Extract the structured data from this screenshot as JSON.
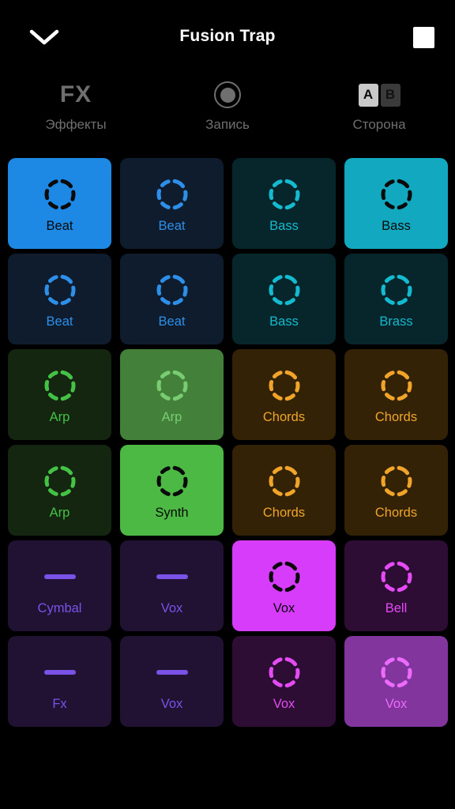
{
  "header": {
    "collapse_icon": "chevron-down-icon",
    "title": "Fusion Trap",
    "stop_icon": "stop-square-icon"
  },
  "toolbar": {
    "items": [
      {
        "glyph": "FX",
        "icon": "fx-icon",
        "label": "Эффекты"
      },
      {
        "glyph": "",
        "icon": "record-circle-icon",
        "label": "Запись"
      },
      {
        "glyph": "",
        "icon": "ab-switch-icon",
        "label": "Сторона",
        "a_label": "A",
        "b_label": "B",
        "selected": "A"
      }
    ]
  },
  "palette": {
    "blue_active_bg": "#1E88E5",
    "blue_idle_bg": "#0E1C2E",
    "blue_accent": "#2D8FE8",
    "teal_active_bg": "#12A8C0",
    "teal_idle_bg": "#07262B",
    "teal_accent": "#14BACF",
    "green_active_bg": "#4CB944",
    "green_semi_bg": "#43813A",
    "green_idle_bg": "#14260F",
    "green_accent": "#44C246",
    "green_semi_accent": "#79CC72",
    "amber_idle_bg": "#332206",
    "amber_accent": "#F0A52A",
    "purple_idle_bg": "#211233",
    "purple_accent": "#7B52E8",
    "magenta_active_bg": "#D63CFA",
    "magenta_semi_bg": "#82359C",
    "magenta_idle_bg": "#2D0D33",
    "magenta_accent": "#E44BF5",
    "magenta_semi_accent": "#EC6BFB",
    "dark_content": "#0A0A0A"
  },
  "grid": {
    "rows": 6,
    "columns": 4,
    "pads": [
      {
        "label": "Beat",
        "icon": "loop-circle-icon",
        "state": "active",
        "family": "blue"
      },
      {
        "label": "Beat",
        "icon": "loop-circle-icon",
        "state": "idle",
        "family": "blue"
      },
      {
        "label": "Bass",
        "icon": "loop-circle-icon",
        "state": "idle",
        "family": "teal"
      },
      {
        "label": "Bass",
        "icon": "loop-circle-icon",
        "state": "active",
        "family": "teal"
      },
      {
        "label": "Beat",
        "icon": "loop-circle-icon",
        "state": "idle",
        "family": "blue"
      },
      {
        "label": "Beat",
        "icon": "loop-circle-icon",
        "state": "idle",
        "family": "blue"
      },
      {
        "label": "Bass",
        "icon": "loop-circle-icon",
        "state": "idle",
        "family": "teal"
      },
      {
        "label": "Brass",
        "icon": "loop-circle-icon",
        "state": "idle",
        "family": "teal"
      },
      {
        "label": "Arp",
        "icon": "loop-circle-icon",
        "state": "idle",
        "family": "green"
      },
      {
        "label": "Arp",
        "icon": "loop-circle-icon",
        "state": "semi",
        "family": "green"
      },
      {
        "label": "Chords",
        "icon": "loop-circle-icon",
        "state": "idle",
        "family": "amber"
      },
      {
        "label": "Chords",
        "icon": "loop-circle-icon",
        "state": "idle",
        "family": "amber"
      },
      {
        "label": "Arp",
        "icon": "loop-circle-icon",
        "state": "idle",
        "family": "green"
      },
      {
        "label": "Synth",
        "icon": "loop-circle-icon",
        "state": "active",
        "family": "green"
      },
      {
        "label": "Chords",
        "icon": "loop-circle-icon",
        "state": "idle",
        "family": "amber"
      },
      {
        "label": "Chords",
        "icon": "loop-circle-icon",
        "state": "idle",
        "family": "amber"
      },
      {
        "label": "Cymbal",
        "icon": "oneshot-bar-icon",
        "state": "idle",
        "family": "purple"
      },
      {
        "label": "Vox",
        "icon": "oneshot-bar-icon",
        "state": "idle",
        "family": "purple"
      },
      {
        "label": "Vox",
        "icon": "loop-circle-icon",
        "state": "active",
        "family": "magenta"
      },
      {
        "label": "Bell",
        "icon": "loop-circle-icon",
        "state": "idle",
        "family": "magenta"
      },
      {
        "label": "Fx",
        "icon": "oneshot-bar-icon",
        "state": "idle",
        "family": "purple"
      },
      {
        "label": "Vox",
        "icon": "oneshot-bar-icon",
        "state": "idle",
        "family": "purple"
      },
      {
        "label": "Vox",
        "icon": "loop-circle-icon",
        "state": "idle",
        "family": "magenta"
      },
      {
        "label": "Vox",
        "icon": "loop-circle-icon",
        "state": "semi",
        "family": "magenta"
      }
    ]
  }
}
